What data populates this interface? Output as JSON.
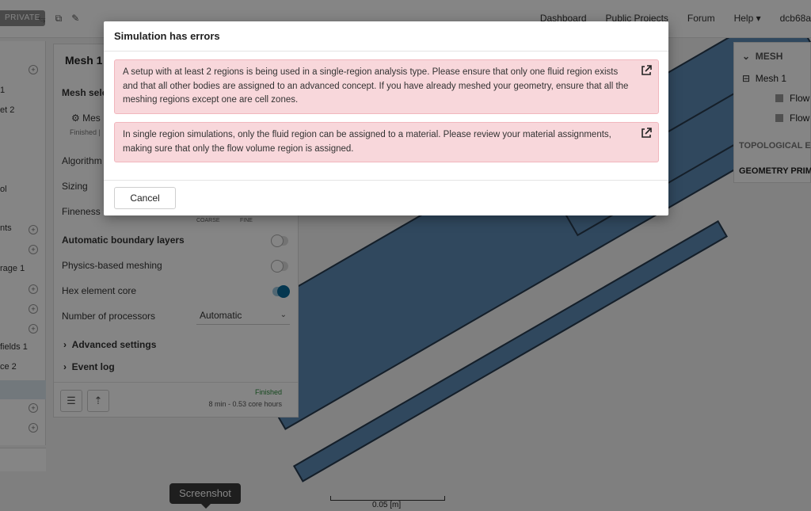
{
  "topbar": {
    "privacy_badge": "PRIVATE",
    "nav": [
      "Dashboard",
      "Public Projects",
      "Forum",
      "Help ▾",
      "dcb68a"
    ]
  },
  "left_tree": {
    "items": [
      "1",
      "et 2",
      "ol",
      "nts",
      "rage 1",
      "fields 1",
      "ce 2"
    ]
  },
  "mesh_panel": {
    "title": "Mesh 1",
    "selection_label": "Mesh selec",
    "selection_item": "Mes",
    "selection_status": "Finished |",
    "algorithm": "Algorithm",
    "sizing": "Sizing",
    "fineness": "Fineness",
    "coarse": "COARSE",
    "fine": "FINE",
    "auto_boundary": "Automatic boundary layers",
    "physics_meshing": "Physics-based meshing",
    "hex_core": "Hex element core",
    "num_processors": "Number of processors",
    "processors_value": "Automatic",
    "advanced": "Advanced settings",
    "event_log": "Event log",
    "status": "Finished",
    "core_hours": "8 min - 0.53 core hours"
  },
  "right_panel": {
    "mesh_header": "MESH",
    "mesh_item": "Mesh 1",
    "flow1": "Flow",
    "flow2": "Flow",
    "topological": "TOPOLOGICAL E",
    "geometry": "GEOMETRY PRIM"
  },
  "viewport": {
    "scale_label": "0.05 [m]",
    "tooltip": "Screenshot"
  },
  "modal": {
    "title": "Simulation has errors",
    "error1": "A setup with at least 2 regions is being used in a single-region analysis type. Please ensure that only one fluid region exists and that all other bodies are assigned to an advanced concept. If you have already meshed your geometry, ensure that all the meshing regions except one are cell zones.",
    "error2": "In single region simulations, only the fluid region can be assigned to a material. Please review your material assignments, making sure that only the flow volume region is assigned.",
    "cancel_label": "Cancel"
  },
  "colors": {
    "alert_bg": "#f8d7db",
    "mesh_blue": "#5d8ab5",
    "toggle_on": "#0a6a9a",
    "status_green": "#2a8a3a"
  }
}
